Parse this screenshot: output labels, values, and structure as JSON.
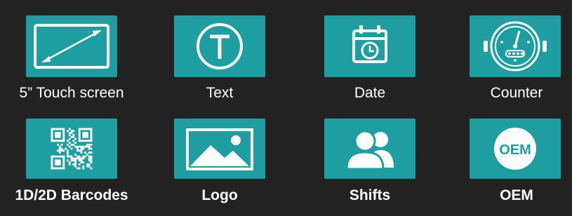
{
  "colors": {
    "background": "#222222",
    "tile": "#1f9ea1",
    "icon": "#ffffff"
  },
  "features": [
    {
      "label": "5” Touch screen",
      "icon": "touchscreen-icon"
    },
    {
      "label": "Text",
      "icon": "text-icon"
    },
    {
      "label": "Date",
      "icon": "calendar-icon"
    },
    {
      "label": "Counter",
      "icon": "counter-icon"
    },
    {
      "label": "1D/2D Barcodes",
      "icon": "qr-code-icon"
    },
    {
      "label": "Logo",
      "icon": "image-icon"
    },
    {
      "label": "Shifts",
      "icon": "users-icon"
    },
    {
      "label": "OEM",
      "icon": "oem-icon",
      "icon_text": "OEM"
    }
  ]
}
